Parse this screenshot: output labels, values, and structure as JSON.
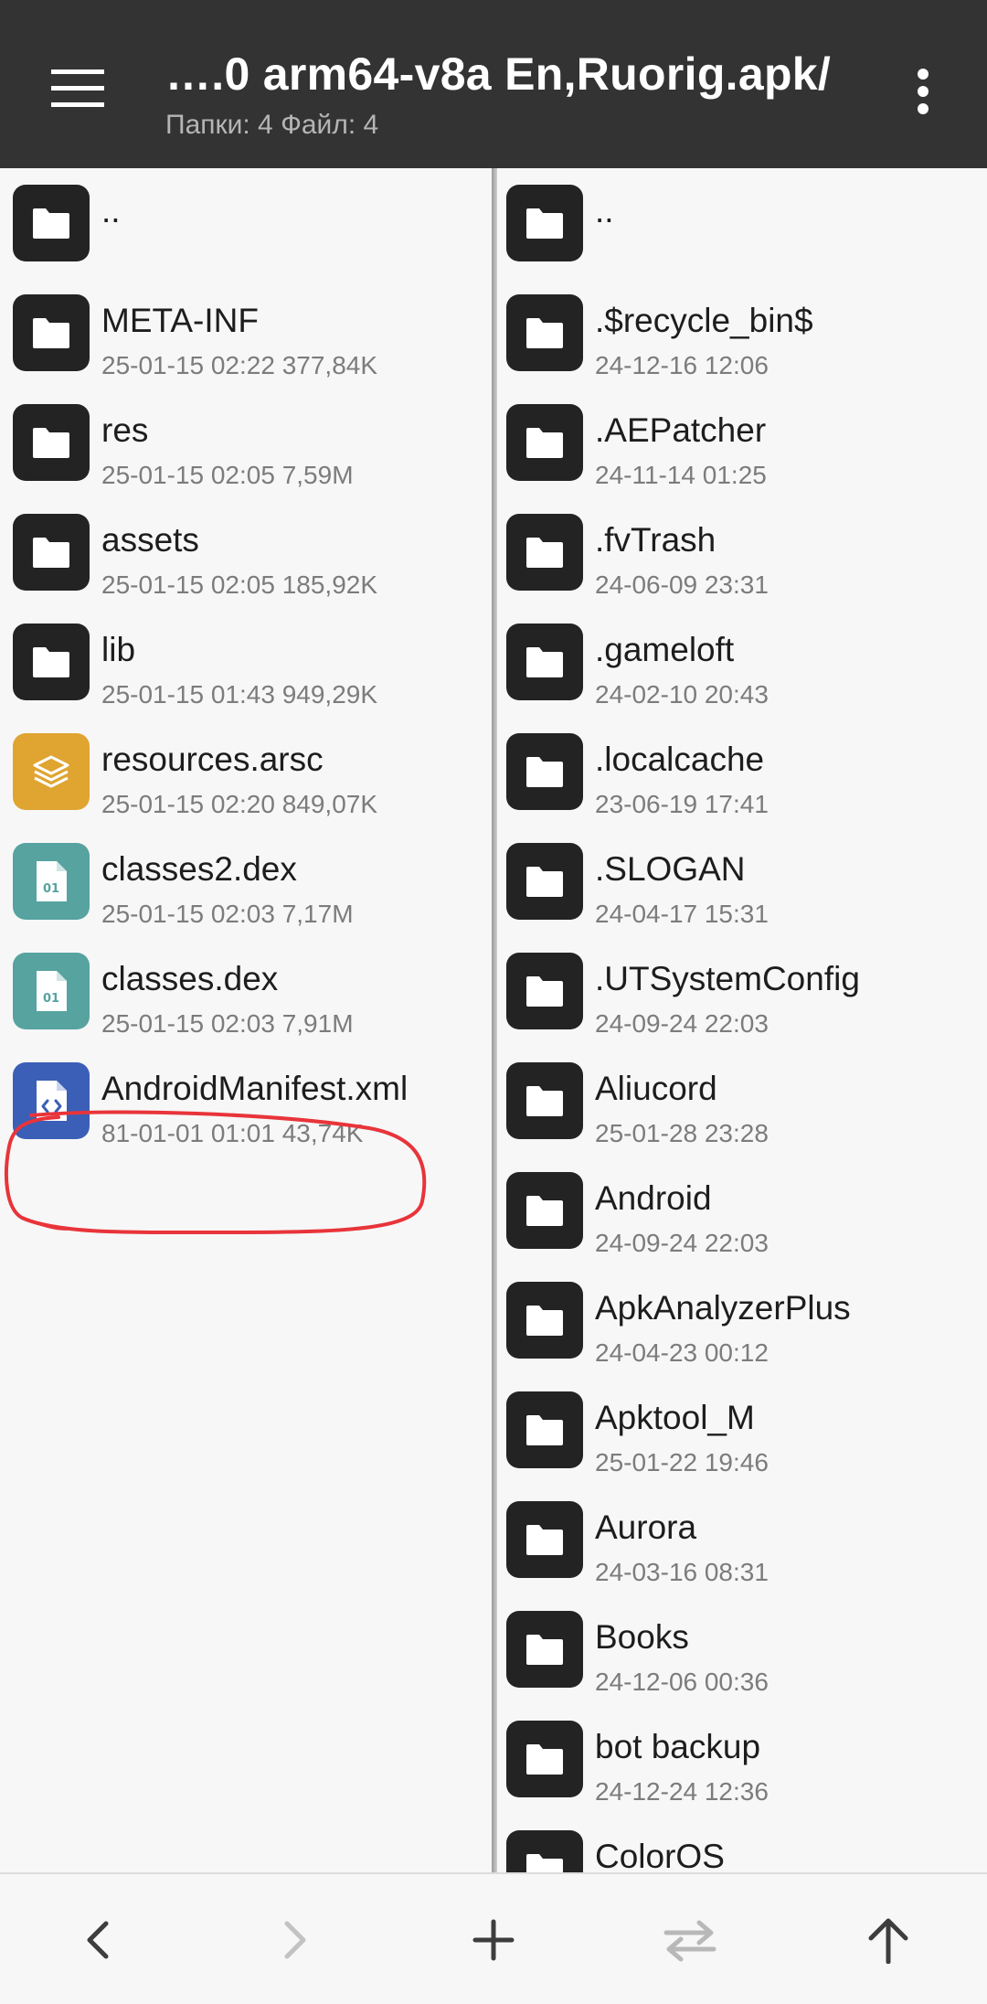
{
  "header": {
    "title": "….0 arm64-v8a En,Ruorig.apk/",
    "subtitle": "Папки: 4  Файл: 4",
    "menu_icon": "hamburger-menu-icon",
    "more_icon": "more-vertical-icon"
  },
  "left_panel": {
    "items": [
      {
        "name": "..",
        "meta": "",
        "icon": "folder"
      },
      {
        "name": "META-INF",
        "meta": "25-01-15 02:22  377,84K",
        "icon": "folder"
      },
      {
        "name": "res",
        "meta": "25-01-15 02:05  7,59M",
        "icon": "folder"
      },
      {
        "name": "assets",
        "meta": "25-01-15 02:05  185,92K",
        "icon": "folder"
      },
      {
        "name": "lib",
        "meta": "25-01-15 01:43  949,29K",
        "icon": "folder"
      },
      {
        "name": "resources.arsc",
        "meta": "25-01-15 02:20  849,07K",
        "icon": "layers"
      },
      {
        "name": "classes2.dex",
        "meta": "25-01-15 02:03  7,17M",
        "icon": "dex"
      },
      {
        "name": "classes.dex",
        "meta": "25-01-15 02:03  7,91M",
        "icon": "dex"
      },
      {
        "name": "AndroidManifest.xml",
        "meta": "81-01-01 01:01  43,74K",
        "icon": "code"
      }
    ]
  },
  "right_panel": {
    "items": [
      {
        "name": "..",
        "meta": ""
      },
      {
        "name": ".$recycle_bin$",
        "meta": "24-12-16 12:06"
      },
      {
        "name": ".AEPatcher",
        "meta": "24-11-14 01:25"
      },
      {
        "name": ".fvTrash",
        "meta": "24-06-09 23:31"
      },
      {
        "name": ".gameloft",
        "meta": "24-02-10 20:43"
      },
      {
        "name": ".localcache",
        "meta": "23-06-19 17:41"
      },
      {
        "name": ".SLOGAN",
        "meta": "24-04-17 15:31"
      },
      {
        "name": ".UTSystemConfig",
        "meta": "24-09-24 22:03"
      },
      {
        "name": "Aliucord",
        "meta": "25-01-28 23:28"
      },
      {
        "name": "Android",
        "meta": "24-09-24 22:03"
      },
      {
        "name": "ApkAnalyzerPlus",
        "meta": "24-04-23 00:12"
      },
      {
        "name": "Apktool_M",
        "meta": "25-01-22 19:46"
      },
      {
        "name": "Aurora",
        "meta": "24-03-16 08:31"
      },
      {
        "name": "Books",
        "meta": "24-12-06 00:36"
      },
      {
        "name": "bot backup",
        "meta": "24-12-24 12:36"
      },
      {
        "name": "ColorOS",
        "meta": ""
      }
    ]
  },
  "dex_label": "01",
  "colors": {
    "header_bg": "#333333",
    "folder_icon_bg": "#232323",
    "arsc_icon_bg": "#e0a431",
    "dex_icon_bg": "#56a3a0",
    "xml_icon_bg": "#3b5fb7",
    "annotation_red": "#e8343a"
  },
  "toolbar": {
    "back_icon": "chevron-left-icon",
    "forward_icon": "chevron-right-icon",
    "add_icon": "plus-icon",
    "swap_icon": "swap-arrows-icon",
    "up_icon": "arrow-up-icon"
  }
}
